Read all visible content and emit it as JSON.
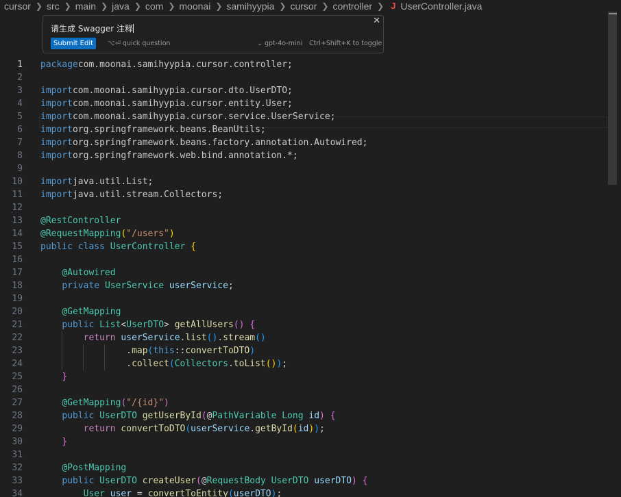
{
  "breadcrumb": {
    "segments": [
      "cursor",
      "src",
      "main",
      "java",
      "com",
      "moonai",
      "samihyypia",
      "cursor",
      "controller"
    ],
    "file_icon": "java-file-icon",
    "file_icon_glyph": "J",
    "file_name": "UserController.java"
  },
  "inline_edit": {
    "input_value": "请生成 Swagger 注释",
    "close_glyph": "✕",
    "submit_label": "Submit Edit",
    "quick_question": "⌥⏎ quick question",
    "model": "⌄ gpt-4o-mini",
    "toggle_hint": "Ctrl+Shift+K to toggle"
  },
  "editor": {
    "active_line": 1,
    "lines": [
      [
        [
          "kw",
          "package"
        ],
        [
          "",
          "com.moonai.samihyypia.cursor.controller;"
        ]
      ],
      [],
      [
        [
          "kw",
          "import"
        ],
        [
          "",
          "com.moonai.samihyypia.cursor.dto.UserDTO;"
        ]
      ],
      [
        [
          "kw",
          "import"
        ],
        [
          "",
          "com.moonai.samihyypia.cursor.entity.User;"
        ]
      ],
      [
        [
          "kw",
          "import"
        ],
        [
          "",
          "com.moonai.samihyypia.cursor.service.UserService;"
        ]
      ],
      [
        [
          "kw",
          "import"
        ],
        [
          "",
          "org.springframework.beans.BeanUtils;"
        ]
      ],
      [
        [
          "kw",
          "import"
        ],
        [
          "",
          "org.springframework.beans.factory.annotation.Autowired;"
        ]
      ],
      [
        [
          "kw",
          "import"
        ],
        [
          "",
          "org.springframework.web.bind.annotation.*;"
        ]
      ],
      [],
      [
        [
          "kw",
          "import"
        ],
        [
          "",
          "java.util.List;"
        ]
      ],
      [
        [
          "kw",
          "import"
        ],
        [
          "",
          "java.util.stream.Collectors;"
        ]
      ],
      [],
      [
        [
          "an",
          "@RestController"
        ]
      ],
      [
        [
          "an",
          "@RequestMapping"
        ],
        [
          "b1",
          "("
        ],
        [
          "str",
          "\"/users\""
        ],
        [
          "b1",
          ")"
        ]
      ],
      [
        [
          "kw",
          "public"
        ],
        [
          "",
          " "
        ],
        [
          "kw",
          "class"
        ],
        [
          "",
          " "
        ],
        [
          "ty",
          "UserController"
        ],
        [
          "",
          " "
        ],
        [
          "b1",
          "{"
        ]
      ],
      [],
      [
        [
          "",
          "    "
        ],
        [
          "an",
          "@Autowired"
        ]
      ],
      [
        [
          "",
          "    "
        ],
        [
          "kw",
          "private"
        ],
        [
          "",
          " "
        ],
        [
          "ty",
          "UserService"
        ],
        [
          "",
          " "
        ],
        [
          "var",
          "userService"
        ],
        [
          "",
          ";"
        ]
      ],
      [],
      [
        [
          "",
          "    "
        ],
        [
          "an",
          "@GetMapping"
        ]
      ],
      [
        [
          "",
          "    "
        ],
        [
          "kw",
          "public"
        ],
        [
          "",
          " "
        ],
        [
          "ty",
          "List"
        ],
        [
          "",
          "<"
        ],
        [
          "ty",
          "UserDTO"
        ],
        [
          "",
          "> "
        ],
        [
          "fn",
          "getAllUsers"
        ],
        [
          "b2",
          "()"
        ],
        [
          "",
          " "
        ],
        [
          "b2",
          "{"
        ]
      ],
      [
        [
          "",
          "        "
        ],
        [
          "kw2",
          "return"
        ],
        [
          "",
          " "
        ],
        [
          "var",
          "userService"
        ],
        [
          "",
          "."
        ],
        [
          "fn",
          "list"
        ],
        [
          "b3",
          "()"
        ],
        [
          "",
          "."
        ],
        [
          "fn",
          "stream"
        ],
        [
          "b3",
          "()"
        ]
      ],
      [
        [
          "",
          "                "
        ],
        [
          "",
          "."
        ],
        [
          "fn",
          "map"
        ],
        [
          "b3",
          "("
        ],
        [
          "kw",
          "this"
        ],
        [
          "",
          "::"
        ],
        [
          "fn",
          "convertToDTO"
        ],
        [
          "b3",
          ")"
        ]
      ],
      [
        [
          "",
          "                "
        ],
        [
          "",
          "."
        ],
        [
          "fn",
          "collect"
        ],
        [
          "b3",
          "("
        ],
        [
          "ty",
          "Collectors"
        ],
        [
          "",
          "."
        ],
        [
          "fn",
          "toList"
        ],
        [
          "b1",
          "()"
        ],
        [
          "b3",
          ")"
        ],
        [
          "",
          ";"
        ]
      ],
      [
        [
          "",
          "    "
        ],
        [
          "b2",
          "}"
        ]
      ],
      [],
      [
        [
          "",
          "    "
        ],
        [
          "an",
          "@GetMapping"
        ],
        [
          "b2",
          "("
        ],
        [
          "str",
          "\"/{id}\""
        ],
        [
          "b2",
          ")"
        ]
      ],
      [
        [
          "",
          "    "
        ],
        [
          "kw",
          "public"
        ],
        [
          "",
          " "
        ],
        [
          "ty",
          "UserDTO"
        ],
        [
          "",
          " "
        ],
        [
          "fn",
          "getUserById"
        ],
        [
          "b2",
          "("
        ],
        [
          "",
          "@"
        ],
        [
          "an",
          "PathVariable"
        ],
        [
          "",
          " "
        ],
        [
          "ty",
          "Long"
        ],
        [
          "",
          " "
        ],
        [
          "var",
          "id"
        ],
        [
          "b2",
          ")"
        ],
        [
          "",
          " "
        ],
        [
          "b2",
          "{"
        ]
      ],
      [
        [
          "",
          "        "
        ],
        [
          "kw2",
          "return"
        ],
        [
          "",
          " "
        ],
        [
          "fn",
          "convertToDTO"
        ],
        [
          "b3",
          "("
        ],
        [
          "var",
          "userService"
        ],
        [
          "",
          "."
        ],
        [
          "fn",
          "getById"
        ],
        [
          "b1",
          "("
        ],
        [
          "var",
          "id"
        ],
        [
          "b1",
          ")"
        ],
        [
          "b3",
          ")"
        ],
        [
          "",
          ";"
        ]
      ],
      [
        [
          "",
          "    "
        ],
        [
          "b2",
          "}"
        ]
      ],
      [],
      [
        [
          "",
          "    "
        ],
        [
          "an",
          "@PostMapping"
        ]
      ],
      [
        [
          "",
          "    "
        ],
        [
          "kw",
          "public"
        ],
        [
          "",
          " "
        ],
        [
          "ty",
          "UserDTO"
        ],
        [
          "",
          " "
        ],
        [
          "fn",
          "createUser"
        ],
        [
          "b2",
          "("
        ],
        [
          "",
          "@"
        ],
        [
          "an",
          "RequestBody"
        ],
        [
          "",
          " "
        ],
        [
          "ty",
          "UserDTO"
        ],
        [
          "",
          " "
        ],
        [
          "var",
          "userDTO"
        ],
        [
          "b2",
          ")"
        ],
        [
          "",
          " "
        ],
        [
          "b2",
          "{"
        ]
      ],
      [
        [
          "",
          "        "
        ],
        [
          "ty",
          "User"
        ],
        [
          "",
          " "
        ],
        [
          "var",
          "user"
        ],
        [
          "",
          " = "
        ],
        [
          "fn",
          "convertToEntity"
        ],
        [
          "b3",
          "("
        ],
        [
          "var",
          "userDTO"
        ],
        [
          "b3",
          ")"
        ],
        [
          "",
          ";"
        ]
      ]
    ]
  }
}
